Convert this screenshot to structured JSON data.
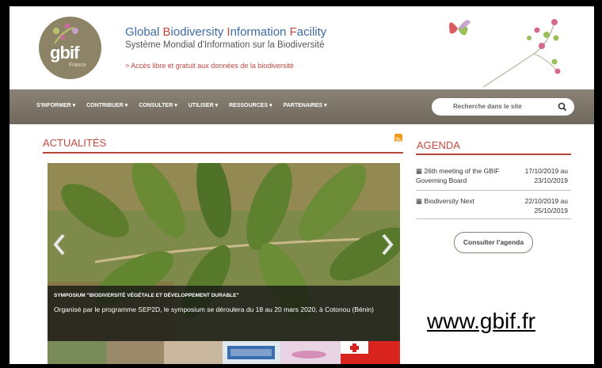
{
  "header": {
    "logo_text": "gbif",
    "logo_sub": "France",
    "title_parts": [
      "Global ",
      "B",
      "iodiversity ",
      "I",
      "nformation ",
      "F",
      "acility"
    ],
    "subtitle": "Système Mondial d'Information sur la Biodiversité",
    "tagline": ">  Accès libre et gratuit aux données de la biodiversité"
  },
  "nav": {
    "items": [
      "S'INFORMER ▾",
      "CONTRIBUER ▾",
      "CONSULTER ▾",
      "UTILISER ▾",
      "RESSOURCES ▾",
      "PARTENAIRES ▾"
    ],
    "search_placeholder": "Recherche dans le site",
    "colors": {
      "bar": "#7c7567",
      "accent": "#c14a3f"
    }
  },
  "news": {
    "title": "ACTUALITÉS",
    "slide_title": "SYMPOSIUM \"BIODIVERSITÉ VÉGÉTALE ET DÉVELOPPEMENT DURABLE\"",
    "slide_text": "Organisé par le programme SEP2D, le symposium se déroulera du 18 au 20 mars 2020, à Cotonou (Bénin)"
  },
  "agenda": {
    "title": "AGENDA",
    "events": [
      {
        "name": "26th meeting of the GBIF Governing Board",
        "date": "17/10/2019 au 23/10/2019"
      },
      {
        "name": "Biodiversity Next",
        "date": "22/10/2019 au 25/10/2019"
      }
    ],
    "button": "Consulter l'agenda"
  },
  "url_label": "www.gbif.fr"
}
